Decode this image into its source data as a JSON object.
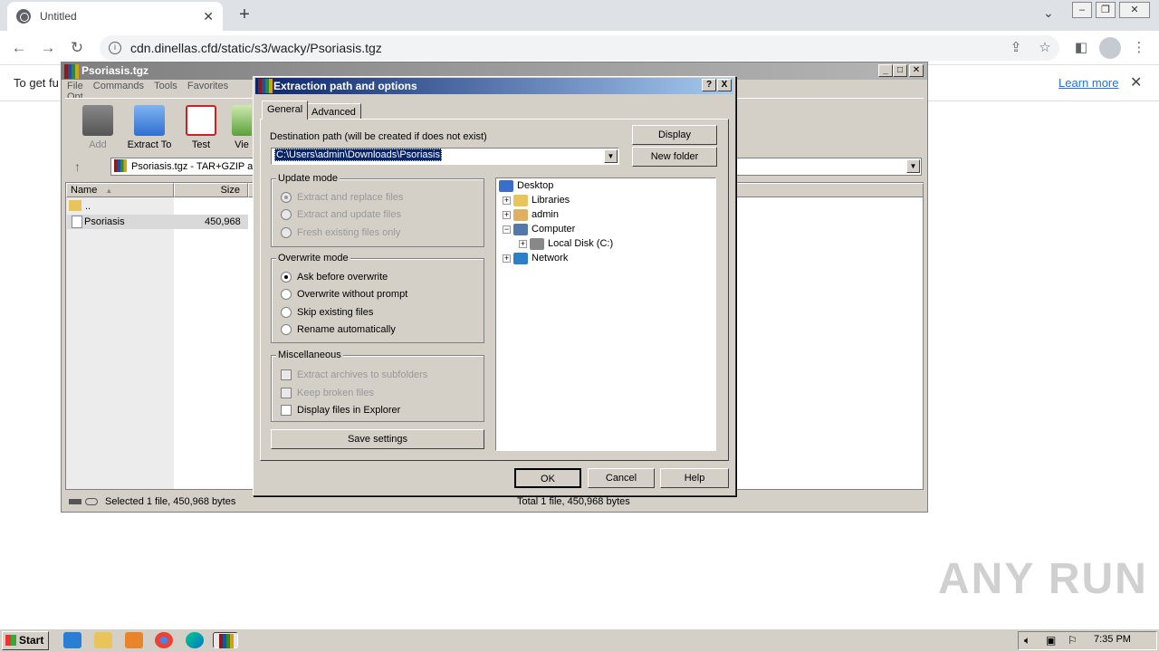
{
  "browser": {
    "tab_title": "Untitled",
    "url": "cdn.dinellas.cfd/static/s3/wacky/Psoriasis.tgz",
    "infobar_text": "To get fu",
    "learn_more": "Learn more"
  },
  "winrar": {
    "title": "Psoriasis.tgz",
    "menu": [
      "File",
      "Commands",
      "Tools",
      "Favorites",
      "Opt"
    ],
    "toolbar": [
      "Add",
      "Extract To",
      "Test",
      "Vie"
    ],
    "path": "Psoriasis.tgz - TAR+GZIP ar",
    "columns": {
      "name": "Name",
      "size": "Size"
    },
    "files": [
      {
        "name": "..",
        "size": ""
      },
      {
        "name": "Psoriasis",
        "size": "450,968"
      }
    ],
    "status_left": "Selected 1 file, 450,968 bytes",
    "status_right": "Total 1 file, 450,968 bytes"
  },
  "dialog": {
    "title": "Extraction path and options",
    "help_btn": "?",
    "close_btn": "X",
    "tabs": [
      "General",
      "Advanced"
    ],
    "dest_label": "Destination path (will be created if does not exist)",
    "dest_value": "C:\\Users\\admin\\Downloads\\Psoriasis",
    "display_btn": "Display",
    "newfolder_btn": "New folder",
    "update_mode": {
      "label": "Update mode",
      "options": [
        "Extract and replace files",
        "Extract and update files",
        "Fresh existing files only"
      ]
    },
    "overwrite_mode": {
      "label": "Overwrite mode",
      "options": [
        "Ask before overwrite",
        "Overwrite without prompt",
        "Skip existing files",
        "Rename automatically"
      ]
    },
    "misc": {
      "label": "Miscellaneous",
      "options": [
        "Extract archives to subfolders",
        "Keep broken files",
        "Display files in Explorer"
      ]
    },
    "save_settings": "Save settings",
    "tree": [
      "Desktop",
      "Libraries",
      "admin",
      "Computer",
      "Local Disk (C:)",
      "Network"
    ],
    "ok": "OK",
    "cancel": "Cancel",
    "help": "Help"
  },
  "taskbar": {
    "start": "Start",
    "clock": "7:35 PM"
  },
  "watermark": "ANY RUN"
}
